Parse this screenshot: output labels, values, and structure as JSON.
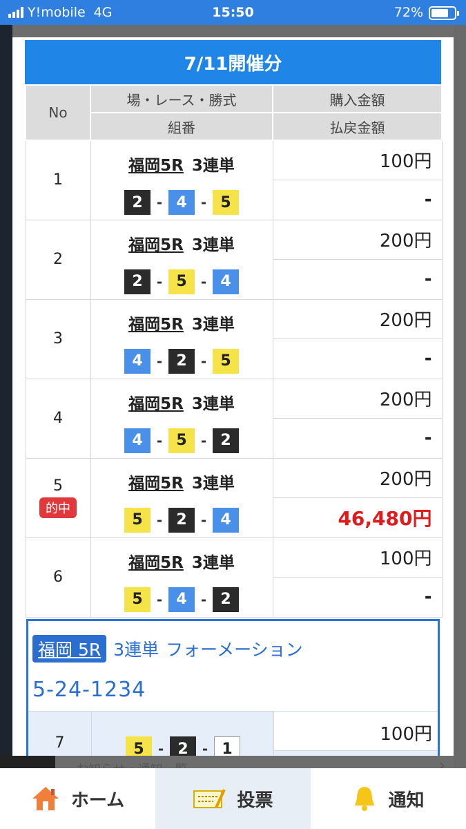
{
  "status_bar": {
    "carrier": "Y!mobile",
    "network": "4G",
    "time": "15:50",
    "battery": "72%",
    "battery_level": 0.72
  },
  "background": {
    "hidden_text": "お知らせ・通知一覧"
  },
  "modal": {
    "title": "7/11開催分",
    "headers": {
      "no": "No",
      "race": "場・レース・勝式",
      "combo": "組番",
      "purchase": "購入金額",
      "payout": "払戻金額"
    },
    "rows": [
      {
        "no": "1",
        "venue": "福岡5R",
        "bet_type": "3連単",
        "combo": [
          {
            "n": "2",
            "c": "black"
          },
          {
            "n": "4",
            "c": "blue"
          },
          {
            "n": "5",
            "c": "yellow"
          }
        ],
        "purchase": "100円",
        "payout": "-",
        "hit": false
      },
      {
        "no": "2",
        "venue": "福岡5R",
        "bet_type": "3連単",
        "combo": [
          {
            "n": "2",
            "c": "black"
          },
          {
            "n": "5",
            "c": "yellow"
          },
          {
            "n": "4",
            "c": "blue"
          }
        ],
        "purchase": "200円",
        "payout": "-",
        "hit": false
      },
      {
        "no": "3",
        "venue": "福岡5R",
        "bet_type": "3連単",
        "combo": [
          {
            "n": "4",
            "c": "blue"
          },
          {
            "n": "2",
            "c": "black"
          },
          {
            "n": "5",
            "c": "yellow"
          }
        ],
        "purchase": "200円",
        "payout": "-",
        "hit": false
      },
      {
        "no": "4",
        "venue": "福岡5R",
        "bet_type": "3連単",
        "combo": [
          {
            "n": "4",
            "c": "blue"
          },
          {
            "n": "5",
            "c": "yellow"
          },
          {
            "n": "2",
            "c": "black"
          }
        ],
        "purchase": "200円",
        "payout": "-",
        "hit": false
      },
      {
        "no": "5",
        "venue": "福岡5R",
        "bet_type": "3連単",
        "combo": [
          {
            "n": "5",
            "c": "yellow"
          },
          {
            "n": "2",
            "c": "black"
          },
          {
            "n": "4",
            "c": "blue"
          }
        ],
        "purchase": "200円",
        "payout": "46,480円",
        "hit": true,
        "badge": "的中"
      },
      {
        "no": "6",
        "venue": "福岡5R",
        "bet_type": "3連単",
        "combo": [
          {
            "n": "5",
            "c": "yellow"
          },
          {
            "n": "4",
            "c": "blue"
          },
          {
            "n": "2",
            "c": "black"
          }
        ],
        "purchase": "100円",
        "payout": "-",
        "hit": false
      }
    ],
    "formation": {
      "venue": "福岡 5R",
      "bet_type": "3連単",
      "method": "フォーメーション",
      "pattern": "5-24-1234",
      "row": {
        "no": "7",
        "combo": [
          {
            "n": "5",
            "c": "yellow"
          },
          {
            "n": "2",
            "c": "black"
          },
          {
            "n": "1",
            "c": "white"
          }
        ],
        "purchase": "100円"
      }
    }
  },
  "bottom_nav": {
    "items": [
      {
        "label": "ホーム",
        "icon": "home-icon"
      },
      {
        "label": "投票",
        "icon": "ticket-icon"
      },
      {
        "label": "通知",
        "icon": "bell-icon"
      }
    ]
  },
  "colors": {
    "accent": "#1f85e6",
    "hit_red": "#e11b1b",
    "boat_black": "#2b2b2b",
    "boat_blue": "#4a8fe8",
    "boat_yellow": "#f6e34a",
    "boat_white": "#ffffff"
  }
}
